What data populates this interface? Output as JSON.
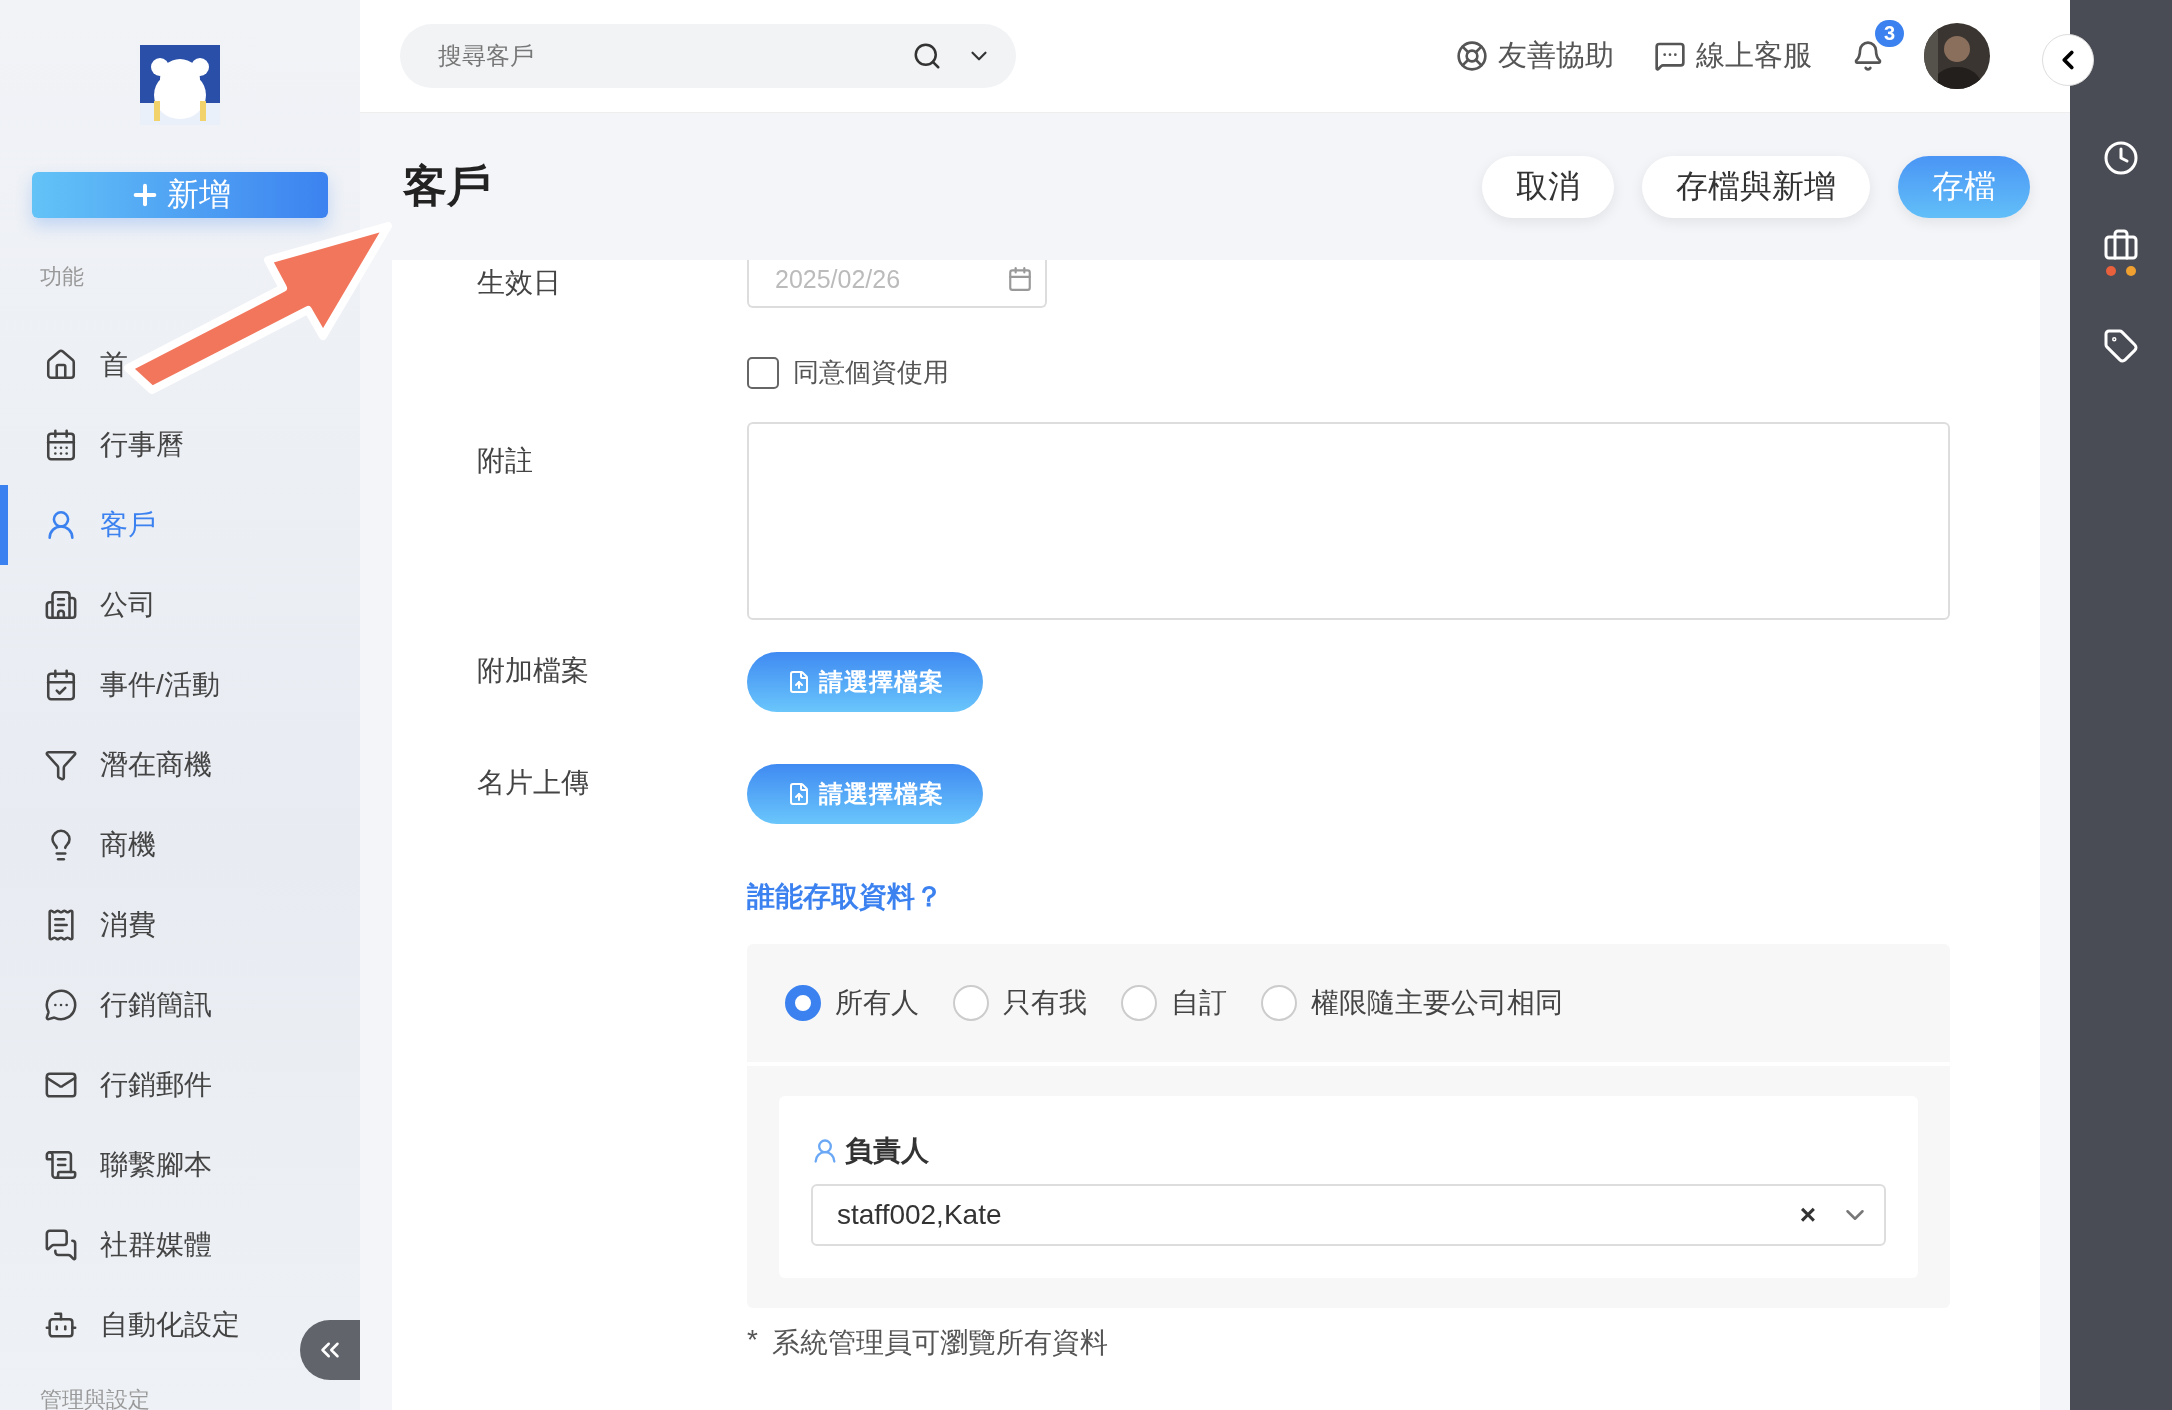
{
  "sidebar": {
    "new_button": "新增",
    "section": "功能",
    "items": [
      {
        "label": "首",
        "selected": false
      },
      {
        "label": "行事曆",
        "selected": false
      },
      {
        "label": "客戶",
        "selected": true
      },
      {
        "label": "公司",
        "selected": false
      },
      {
        "label": "事件/活動",
        "selected": false
      },
      {
        "label": "潛在商機",
        "selected": false
      },
      {
        "label": "商機",
        "selected": false
      },
      {
        "label": "消費",
        "selected": false
      },
      {
        "label": "行銷簡訊",
        "selected": false
      },
      {
        "label": "行銷郵件",
        "selected": false
      },
      {
        "label": "聯繫腳本",
        "selected": false
      },
      {
        "label": "社群媒體",
        "selected": false
      },
      {
        "label": "自動化設定",
        "selected": false
      }
    ],
    "next_section": "管理與設定"
  },
  "topbar": {
    "search": {
      "placeholder": "搜尋客戶"
    },
    "links": [
      "友善協助",
      "線上客服"
    ],
    "notifications": "3"
  },
  "page": {
    "title": "客戶",
    "buttons": [
      {
        "label": "取消",
        "kind": "plain"
      },
      {
        "label": "存檔與新增",
        "kind": "plain"
      },
      {
        "label": "存檔",
        "kind": "primary"
      }
    ]
  },
  "form": {
    "date": {
      "label": "生效日",
      "placeholder": "2025/02/26"
    },
    "consent": {
      "label": "同意個資使用",
      "checked": false
    },
    "note": {
      "label": "附註"
    },
    "uploads": [
      {
        "label": "附加檔案",
        "button": "請選擇檔案"
      },
      {
        "label": "名片上傳",
        "button": "請選擇檔案"
      }
    ],
    "access": {
      "link": "誰能存取資料？",
      "options": [
        {
          "label": "所有人",
          "selected": true
        },
        {
          "label": "只有我",
          "selected": false
        },
        {
          "label": "自訂",
          "selected": false
        },
        {
          "label": "權限隨主要公司相同",
          "selected": false
        }
      ],
      "owner": {
        "label": "負責人",
        "value": "staff002,Kate",
        "clear": "×"
      },
      "note": "系統管理員可瀏覽所有資料",
      "note_mark": "*"
    }
  },
  "annotation": {
    "kind": "arrow"
  }
}
